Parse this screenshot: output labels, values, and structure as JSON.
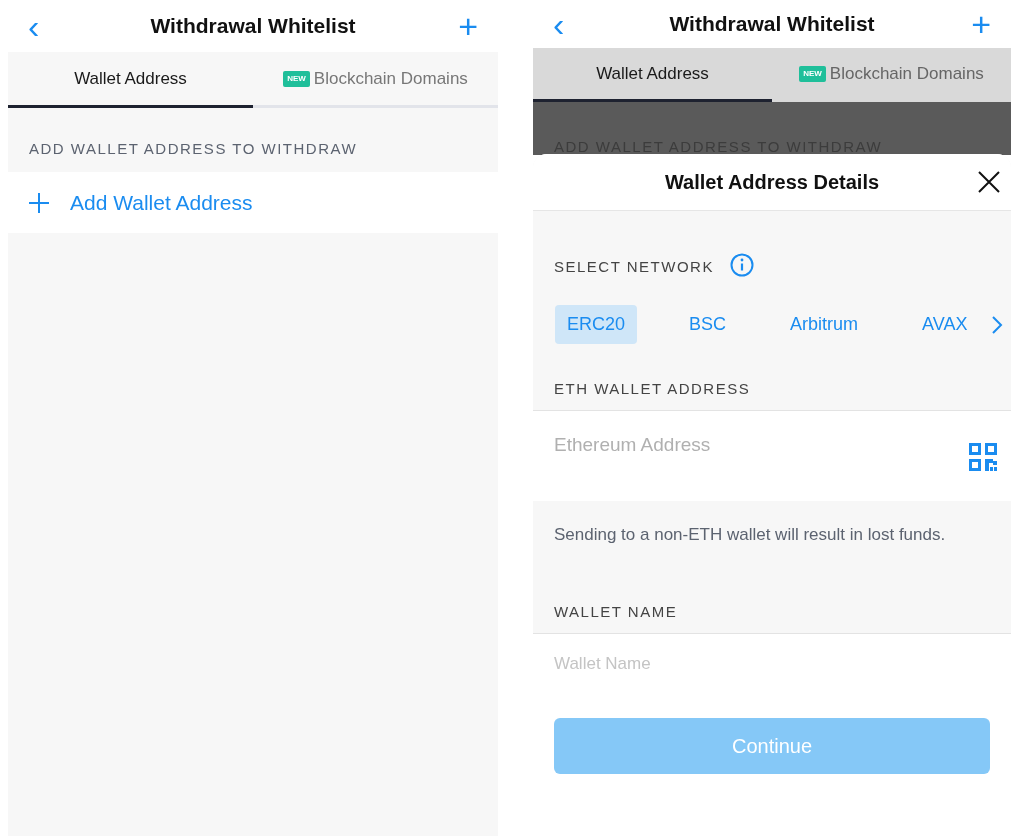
{
  "screens": [
    {
      "dimmed": false,
      "header": {
        "back": "‹",
        "title": "Withdrawal Whitelist",
        "add": "+"
      },
      "tabs": [
        {
          "label": "Wallet Address",
          "selected": true
        },
        {
          "label": "Blockchain Domains",
          "badge": "NEW",
          "selected": false
        }
      ],
      "section_label": "ADD WALLET ADDRESS TO WITHDRAW",
      "add_row": {
        "label": "Add Wallet Address"
      }
    },
    {
      "dimmed": true,
      "header": {
        "back": "‹",
        "title": "Withdrawal Whitelist",
        "add": "+"
      },
      "tabs": [
        {
          "label": "Wallet Address",
          "selected": true
        },
        {
          "label": "Blockchain Domains",
          "badge": "NEW",
          "selected": false
        }
      ],
      "section_label": "ADD WALLET ADDRESS TO WITHDRAW",
      "sheet": {
        "title": "Wallet Address Details",
        "network_label": "SELECT NETWORK",
        "networks": [
          {
            "label": "ERC20",
            "selected": true
          },
          {
            "label": "BSC",
            "selected": false
          },
          {
            "label": "Arbitrum",
            "selected": false
          },
          {
            "label": "AVAX",
            "selected": false
          }
        ],
        "address_label": "ETH WALLET ADDRESS",
        "address_field": {
          "placeholder": "Ethereum Address"
        },
        "warning": "Sending to a non-ETH wallet will result in lost funds.",
        "name_label": "WALLET NAME",
        "name_field": {
          "placeholder": "Wallet Name"
        },
        "button": {
          "label": "Continue",
          "disabled": true
        }
      }
    }
  ]
}
